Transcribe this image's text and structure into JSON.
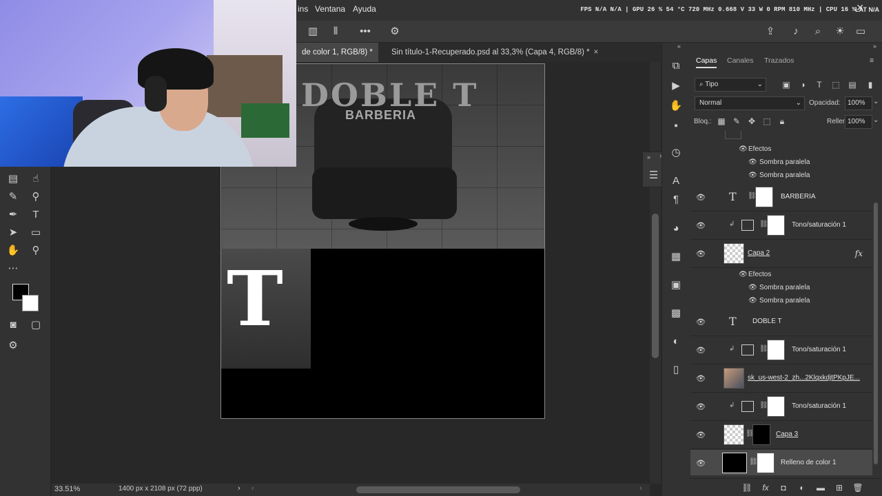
{
  "menubar": {
    "items": [
      "ins",
      "Ventana",
      "Ayuda"
    ],
    "stats": "FPS N/A N/A | GPU 26 % 54 °C 720 MHz 0.668 V 33 W 0 RPM 810 MHz | CPU 16 %",
    "extra": "LAT N/A"
  },
  "tabs": [
    {
      "label": "de color 1, RGB/8) *",
      "active": true
    },
    {
      "label": "Sin título-1-Recuperado.psd al 33,3% (Capa 4, RGB/8) *",
      "active": false
    }
  ],
  "canvas": {
    "logo_main": "DOBLE T",
    "logo_sub": "BARBERIA",
    "monogram": "T"
  },
  "status": {
    "zoom": "33.51%",
    "doc_info": "1400 px x 2108 px (72 ppp)"
  },
  "layers_panel": {
    "tabs": [
      "Capas",
      "Canales",
      "Trazados"
    ],
    "filter_label": "Tipo",
    "blend_mode": "Normal",
    "opacity_label": "Opacidad:",
    "opacity_value": "100%",
    "lock_label": "Bloq.:",
    "fill_label": "Relleno:",
    "fill_value": "100%",
    "effects_label": "Efectos",
    "drop_shadow": "Sombra paralela",
    "layers": [
      {
        "name": "BARBERIA",
        "type": "text"
      },
      {
        "name": "Tono/saturación 1",
        "type": "adjustment"
      },
      {
        "name": "Capa 2",
        "type": "pixel",
        "fx": "fx"
      },
      {
        "name": "DOBLE T",
        "type": "text"
      },
      {
        "name": "Tono/saturación 1",
        "type": "adjustment"
      },
      {
        "name": "sk_us-west-2_zh...2KlqxkdjtPKpJE...",
        "type": "photo"
      },
      {
        "name": "Tono/saturación 1",
        "type": "adjustment"
      },
      {
        "name": "Capa 3",
        "type": "masked"
      },
      {
        "name": "Relleno de color 1",
        "type": "fill"
      }
    ]
  }
}
